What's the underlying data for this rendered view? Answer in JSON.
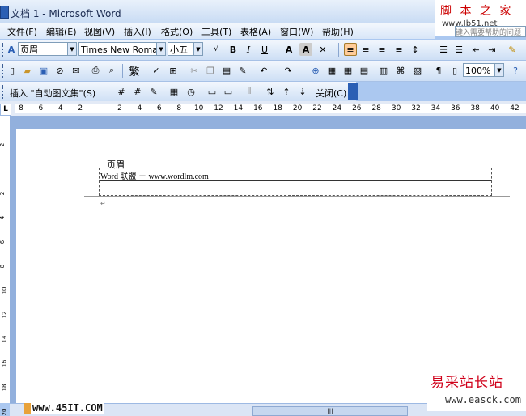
{
  "title": "文档 1 - Microsoft Word",
  "watermark_top": {
    "line1": "脚 本 之 家",
    "line2": "www.Jb51.net"
  },
  "help_box_placeholder": "键入需要帮助的问题",
  "menu": [
    "文件(F)",
    "编辑(E)",
    "视图(V)",
    "插入(I)",
    "格式(O)",
    "工具(T)",
    "表格(A)",
    "窗口(W)",
    "帮助(H)"
  ],
  "format_bar": {
    "style": "页眉",
    "font": "Times New Roman",
    "size": "小五",
    "bold": "B",
    "italic": "I",
    "underline": "U"
  },
  "standard_bar": {
    "zoom": "100%",
    "traditional": "繁"
  },
  "header_footer_bar": {
    "insert_autotext": "插入 \"自动图文集\"(S)",
    "close": "关闭(C)"
  },
  "ruler_ticks": [
    "8",
    "6",
    "4",
    "2",
    "",
    "2",
    "4",
    "6",
    "8",
    "10",
    "12",
    "14",
    "16",
    "18",
    "20",
    "22",
    "24",
    "26",
    "28",
    "30",
    "32",
    "34",
    "36",
    "38",
    "40",
    "42"
  ],
  "vruler_ticks": [
    "2",
    "",
    "2",
    "4",
    "6",
    "8",
    "10",
    "12",
    "14",
    "16",
    "18",
    "20"
  ],
  "document": {
    "header_label": "页眉",
    "header_text": "Word 联盟 － www.wordlm.com",
    "para_mark": "↵"
  },
  "watermark_bottom_left": "www.45IT.COM",
  "watermark_bottom_right": {
    "line1": "易采站长站",
    "line2": "www.easck.com"
  }
}
